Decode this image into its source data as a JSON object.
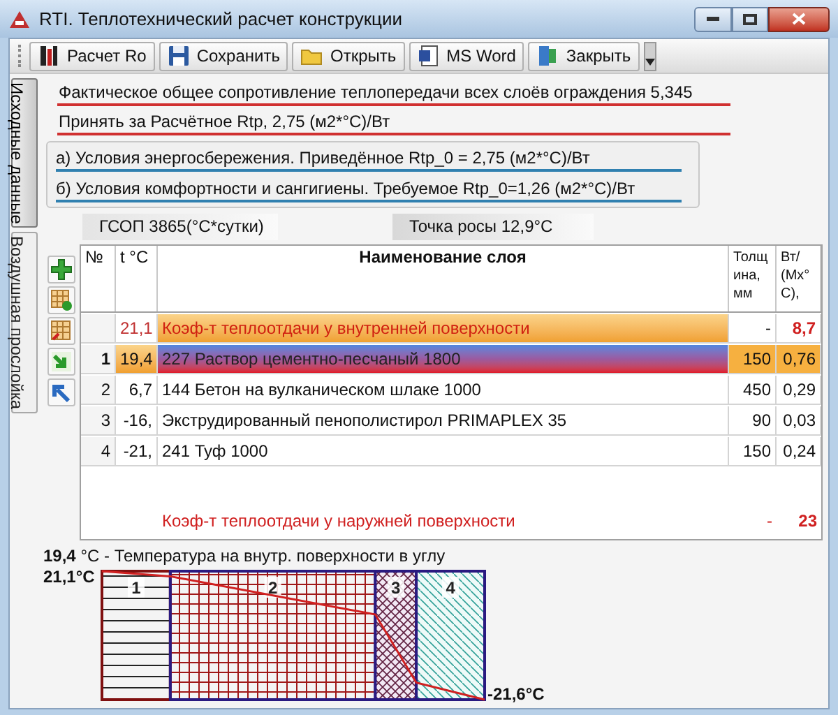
{
  "window": {
    "title": "RTI. Теплотехнический расчет конструкции"
  },
  "toolbar": [
    {
      "label": "Расчет Ro",
      "kind": "calculate"
    },
    {
      "label": "Сохранить",
      "kind": "save"
    },
    {
      "label": "Открыть",
      "kind": "open"
    },
    {
      "label": "MS Word",
      "kind": "export"
    },
    {
      "label": "Закрыть",
      "kind": "close"
    }
  ],
  "tabs": [
    {
      "label": "Исходные данные",
      "selected": true
    },
    {
      "label": "Воздушная прослойка",
      "selected": false
    }
  ],
  "results": [
    "Фактическое общее сопротивление теплопередачи всех слоёв ограждения 5,345",
    "Принять за Расчётное Rtp, 2,75 (м2*°C)/Вт"
  ],
  "conditions": [
    "а) Условия энергосбережения. Приведённое Rtp_0 = 2,75 (м2*°C)/Вт",
    "б) Условия комфортности и сангигиены. Требуемое Rtp_0=1,26 (м2*°C)/Вт"
  ],
  "gsop": "ГСОП 3865(°C*сутки)",
  "dew_point": "Точка росы 12,9°C",
  "table": {
    "columns": [
      "№",
      "t °C",
      "Наименование слоя",
      "Толщина, мм",
      "Вт/(Мх°С),"
    ],
    "rows": [
      {
        "kind": "surface",
        "number": "",
        "t": "21,1",
        "name": "Коэф-т теплоотдачи у внутренней поверхности",
        "thickness": "-",
        "lambda": "8,7",
        "selected": false
      },
      {
        "kind": "layer",
        "number": "1",
        "t": "19,4",
        "name": "227 Раствор цементно-песчаный 1800",
        "thickness": "150",
        "lambda": "0,76",
        "selected": true
      },
      {
        "kind": "layer",
        "number": "2",
        "t": "6,7",
        "name": "144 Бетон на вулканическом шлаке 1000",
        "thickness": "450",
        "lambda": "0,29",
        "selected": false
      },
      {
        "kind": "layer",
        "number": "3",
        "t": "-16,",
        "name": "Экструдированный пенополистирол PRIMAPLEX 35",
        "thickness": "90",
        "lambda": "0,03",
        "selected": false
      },
      {
        "kind": "layer",
        "number": "4",
        "t": "-21,",
        "name": "241 Туф 1000",
        "thickness": "150",
        "lambda": "0,24",
        "selected": false
      }
    ],
    "footer": {
      "name": "Коэф-т теплоотдачи у наружней поверхности",
      "thickness": "-",
      "lambda": "23"
    }
  },
  "diagram": {
    "caption": "**19,4** °C - Температура на внутр. поверхности в углу",
    "inner_temp": "21,1°C",
    "outer_temp": "-21,6°C",
    "layers": [
      {
        "label": "1",
        "kind": "horizontal"
      },
      {
        "label": "2",
        "kind": "grid"
      },
      {
        "label": "3",
        "kind": "crosshatch"
      },
      {
        "label": "4",
        "kind": "diagonal"
      }
    ]
  }
}
